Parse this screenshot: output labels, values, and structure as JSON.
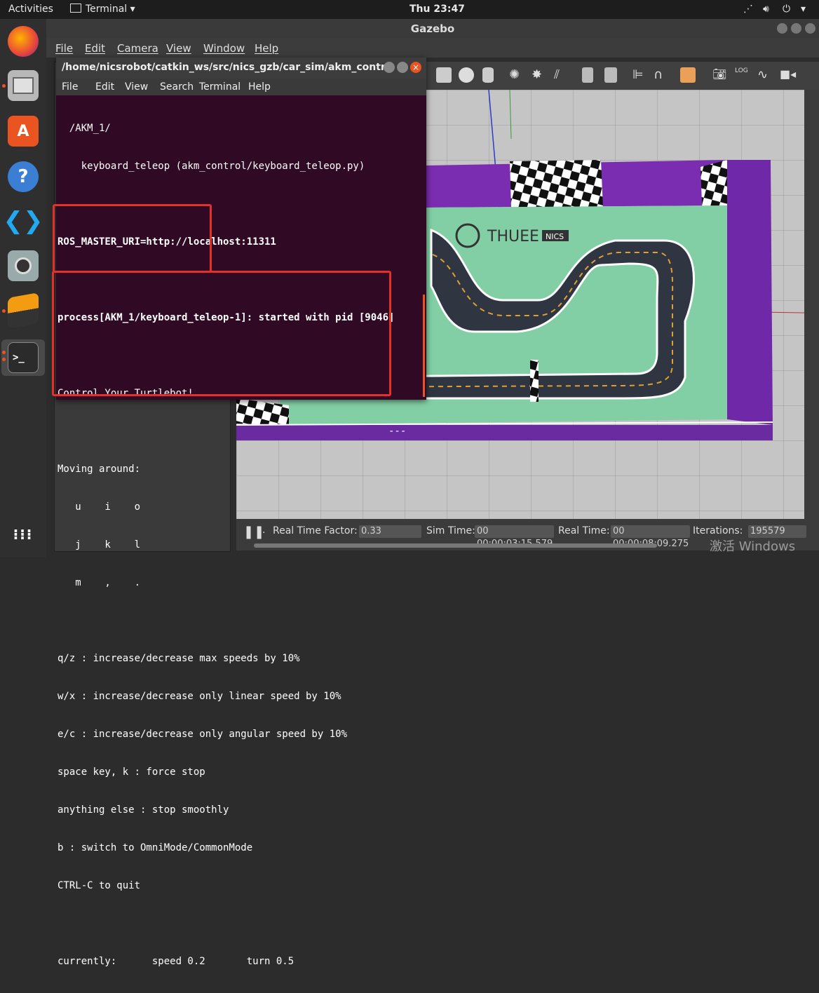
{
  "topbar": {
    "activities": "Activities",
    "app_name": "Terminal",
    "clock": "Thu 23:47"
  },
  "gazebo": {
    "window_title": "Gazebo",
    "menu": [
      "File",
      "Edit",
      "Camera",
      "View",
      "Window",
      "Help"
    ],
    "bottom": {
      "pause_icon": "pause-icon",
      "dot": ".",
      "rtf_label": "Real Time Factor:",
      "rtf_value": "0.33",
      "sim_label": "Sim Time:",
      "sim_value": "00 00:00:03:15.579",
      "real_label": "Real Time:",
      "real_value": "00 00:00:08:09.275",
      "iter_label": "Iterations:",
      "iter_value": "195579"
    },
    "track": {
      "logo": "THUEE",
      "logo_suffix": "NICS"
    }
  },
  "terminal": {
    "title": "/home/nicsrobot/catkin_ws/src/nics_gzb/car_sim/akm_control/...",
    "menu": [
      "File",
      "Edit",
      "View",
      "Search",
      "Terminal",
      "Help"
    ],
    "lines": [
      "  /AKM_1/",
      "    keyboard_teleop (akm_control/keyboard_teleop.py)",
      "",
      "ROS_MASTER_URI=http://localhost:11311",
      "",
      "process[AKM_1/keyboard_teleop-1]: started with pid [9046]",
      "",
      "Control Your Turtlebot!",
      "                                                        ---",
      "Moving around:",
      "   u    i    o",
      "   j    k    l",
      "   m    ,    .",
      "",
      "q/z : increase/decrease max speeds by 10%",
      "w/x : increase/decrease only linear speed by 10%",
      "e/c : increase/decrease only angular speed by 10%",
      "space key, k : force stop",
      "anything else : stop smoothly",
      "b : switch to OmniMode/CommonMode",
      "CTRL-C to quit",
      "",
      "currently:      speed 0.2       turn 0.5"
    ]
  },
  "watermark": "激活 Windows",
  "colors": {
    "ubuntu_orange": "#e95420",
    "terminal_bg": "#300a24",
    "highlight_red": "#e3302a"
  }
}
